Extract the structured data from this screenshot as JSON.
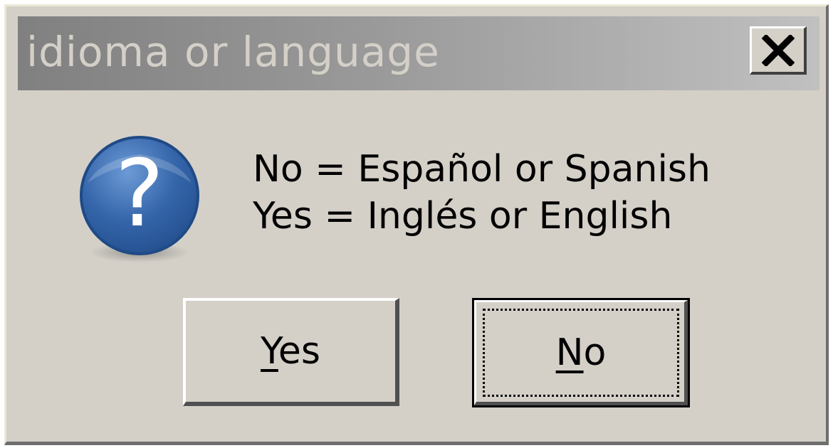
{
  "window": {
    "title": "idioma or language"
  },
  "icons": {
    "title_close": "close-icon",
    "dialog": "question-icon"
  },
  "message": {
    "line1": "No = Español or Spanish",
    "line2": "Yes = Inglés or English"
  },
  "buttons": {
    "yes": {
      "mnemonic": "Y",
      "rest": "es"
    },
    "no": {
      "mnemonic": "N",
      "rest": "o"
    }
  },
  "colors": {
    "dialog_bg": "#d4d0c8",
    "titlebar_inactive_start": "#808080",
    "titlebar_inactive_end": "#c0c0c0",
    "icon_blue": "#2f63a8"
  }
}
